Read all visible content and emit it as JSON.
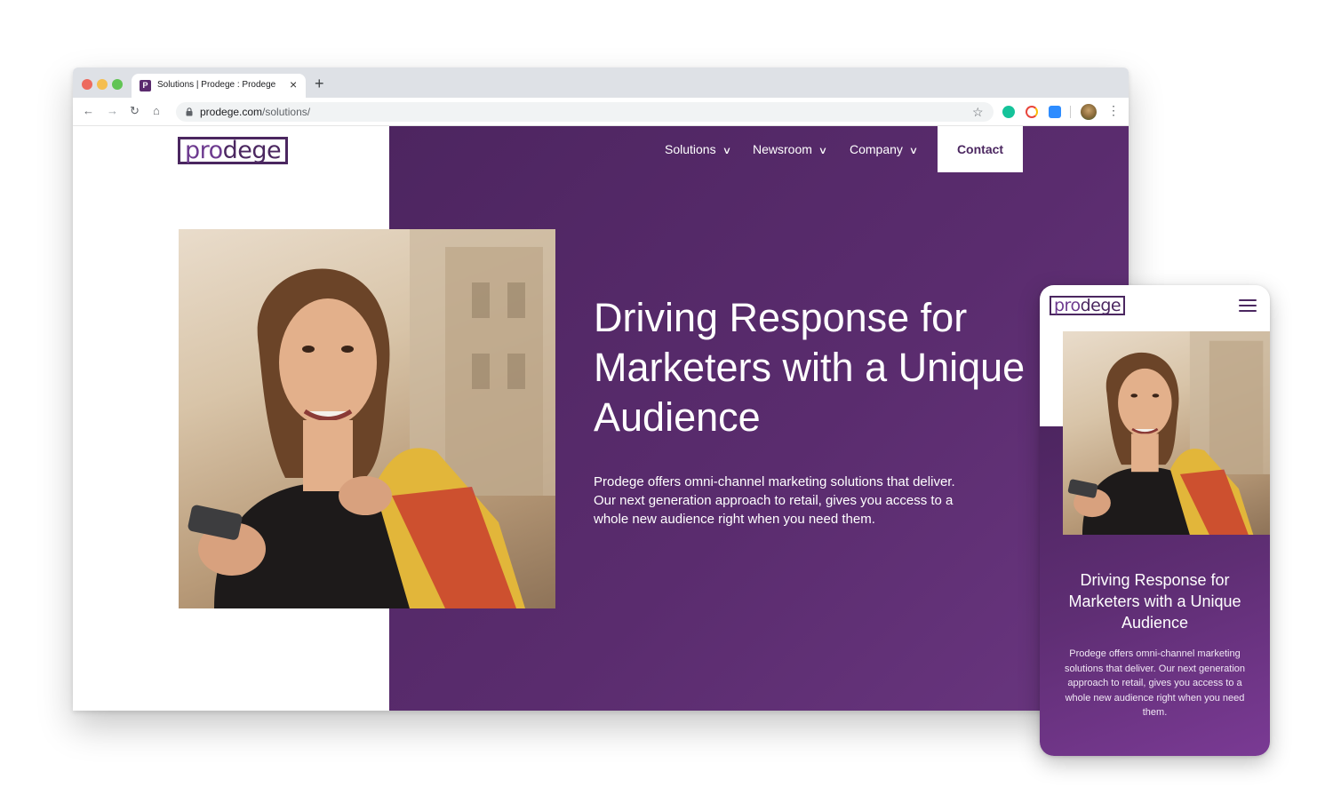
{
  "browser": {
    "tab_title": "Solutions | Prodege : Prodege",
    "favicon_letter": "P",
    "url_host": "prodege.com",
    "url_path": "/solutions/"
  },
  "site": {
    "logo_text_a": "pro",
    "logo_text_b": "dege",
    "nav": [
      {
        "label": "Solutions"
      },
      {
        "label": "Newsroom"
      },
      {
        "label": "Company"
      }
    ],
    "contact_label": "Contact",
    "brand_color": "#4b2760",
    "panel_color": "#5a2c6e"
  },
  "hero": {
    "headline": "Driving Response for Marketers with a Unique Audience",
    "body": "Prodege offers omni-channel marketing solutions that deliver. Our next generation approach to retail, gives you access to a whole new audience right when you need them."
  },
  "mobile": {
    "headline": "Driving Response for Marketers with a Unique Audience",
    "body": "Prodege offers omni-channel marketing solutions that deliver. Our next generation approach to retail, gives you access to a whole new audience right when you need them."
  }
}
